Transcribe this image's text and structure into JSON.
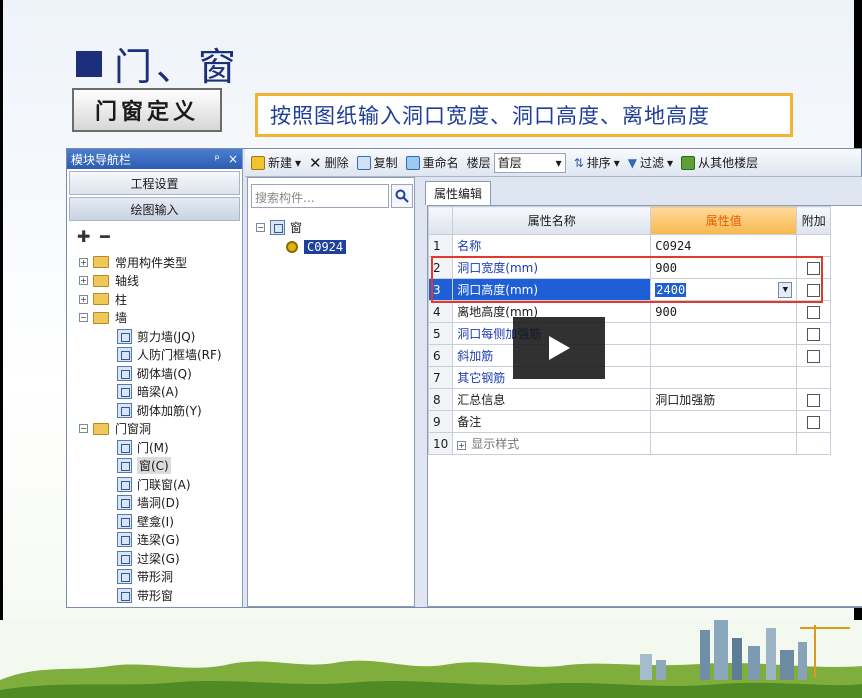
{
  "slide": {
    "title": "门、窗",
    "define_button": "门窗定义",
    "instruction": "按照图纸输入洞口宽度、洞口高度、离地高度"
  },
  "nav_panel": {
    "title": "模块导航栏",
    "pin_label": "ᵖ",
    "close_label": "×",
    "project_settings": "工程设置",
    "drawing_input": "绘图输入",
    "tree": [
      {
        "label": "常用构件类型",
        "level": 0,
        "expander": "+"
      },
      {
        "label": "轴线",
        "level": 0,
        "expander": "+"
      },
      {
        "label": "柱",
        "level": 0,
        "expander": "+"
      },
      {
        "label": "墙",
        "level": 0,
        "expander": "−"
      },
      {
        "label": "剪力墙(JQ)",
        "level": 1
      },
      {
        "label": "人防门框墙(RF)",
        "level": 1
      },
      {
        "label": "砌体墙(Q)",
        "level": 1
      },
      {
        "label": "暗梁(A)",
        "level": 1
      },
      {
        "label": "砌体加筋(Y)",
        "level": 1
      },
      {
        "label": "门窗洞",
        "level": 0,
        "expander": "−"
      },
      {
        "label": "门(M)",
        "level": 1
      },
      {
        "label": "窗(C)",
        "level": 1,
        "selected": true
      },
      {
        "label": "门联窗(A)",
        "level": 1
      },
      {
        "label": "墙洞(D)",
        "level": 1
      },
      {
        "label": "壁龛(I)",
        "level": 1
      },
      {
        "label": "连梁(G)",
        "level": 1
      },
      {
        "label": "过梁(G)",
        "level": 1
      },
      {
        "label": "带形洞",
        "level": 1
      },
      {
        "label": "带形窗",
        "level": 1
      }
    ]
  },
  "toolbar": {
    "new": "新建",
    "delete": "删除",
    "copy": "复制",
    "rename": "重命名",
    "floor_label": "楼层",
    "floor_value": "首层",
    "sort": "排序",
    "filter": "过滤",
    "copy_from_floor": "从其他楼层"
  },
  "component_tree": {
    "search_placeholder": "搜索构件...",
    "root": "窗",
    "root_expander": "−",
    "selected_item": "C0924"
  },
  "properties": {
    "tab": "属性编辑",
    "headers": {
      "name": "属性名称",
      "value": "属性值",
      "extra": "附加"
    },
    "rows": [
      {
        "idx": "1",
        "name": "名称",
        "value": "C0924",
        "blue": true,
        "checkbox": false
      },
      {
        "idx": "2",
        "name": "洞口宽度(mm)",
        "value": "900",
        "blue": true,
        "checkbox": true
      },
      {
        "idx": "3",
        "name": "洞口高度(mm)",
        "value": "2400",
        "blue": true,
        "checkbox": true,
        "editing": true
      },
      {
        "idx": "4",
        "name": "离地高度(mm)",
        "value": "900",
        "blue": false,
        "checkbox": true
      },
      {
        "idx": "5",
        "name": "洞口每侧加强筋",
        "value": "",
        "blue": true,
        "checkbox": true
      },
      {
        "idx": "6",
        "name": "斜加筋",
        "value": "",
        "blue": true,
        "checkbox": true
      },
      {
        "idx": "7",
        "name": "其它钢筋",
        "value": "",
        "blue": true,
        "checkbox": false
      },
      {
        "idx": "8",
        "name": "汇总信息",
        "value": "洞口加强筋",
        "blue": false,
        "checkbox": true
      },
      {
        "idx": "9",
        "name": "备注",
        "value": "",
        "blue": false,
        "checkbox": true
      },
      {
        "idx": "10",
        "name": "显示样式",
        "value": "",
        "blue": false,
        "checkbox": false,
        "expander": "+"
      }
    ]
  },
  "colors": {
    "title_blue": "#1c2f7a",
    "instruction_border": "#f2b233",
    "highlight_red": "#e03a2f",
    "selection_blue": "#1e5fd6",
    "value_header_orange": "#e35d00"
  }
}
